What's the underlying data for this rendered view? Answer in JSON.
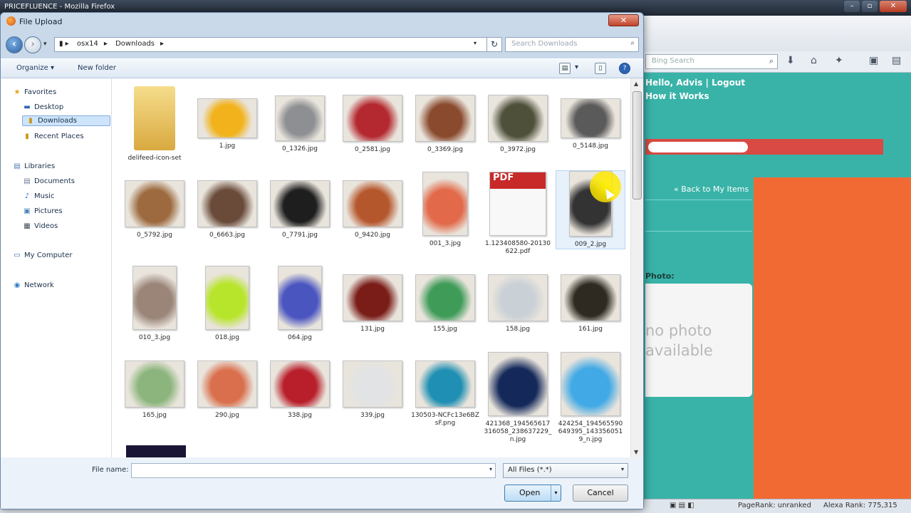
{
  "browser": {
    "title": "PRICEFLUENCE - Mozilla Firefox",
    "search_placeholder": "Bing Search",
    "greeting_line1": "Hello, Advis | Logout",
    "greeting_line2": "How it Works",
    "back_link": "« Back to My Items",
    "photo_label": "Photo:",
    "no_photo_line1": "no photo",
    "no_photo_line2": "available",
    "status_pagerank": "PageRank: unranked",
    "status_alexa": "Alexa Rank: 775,315",
    "colors": {
      "page_bg": "#39b3a8",
      "bar": "#d84a43",
      "panel": "#f26a33"
    }
  },
  "dialog": {
    "title": "File Upload",
    "close_label": "✕",
    "breadcrumb": [
      "osx14",
      "Downloads"
    ],
    "search_placeholder": "Search Downloads",
    "toolbar": {
      "organize": "Organize ▾",
      "new_folder": "New folder"
    },
    "nav": {
      "favorites": "Favorites",
      "desktop": "Desktop",
      "downloads": "Downloads",
      "recent": "Recent Places",
      "libraries": "Libraries",
      "documents": "Documents",
      "music": "Music",
      "pictures": "Pictures",
      "videos": "Videos",
      "computer": "My Computer",
      "network": "Network"
    },
    "files": [
      "delifeed-icon-set",
      "1.jpg",
      "0_1326.jpg",
      "0_2581.jpg",
      "0_3369.jpg",
      "0_3972.jpg",
      "0_5148.jpg",
      "0_5792.jpg",
      "0_6663.jpg",
      "0_7791.jpg",
      "0_9420.jpg",
      "001_3.jpg",
      "1.123408580-20130622.pdf",
      "009_2.jpg",
      "010_3.jpg",
      "018.jpg",
      "064.jpg",
      "131.jpg",
      "155.jpg",
      "158.jpg",
      "161.jpg",
      "165.jpg",
      "290.jpg",
      "338.jpg",
      "339.jpg",
      "130503-NCFc13e6BZsF.png",
      "421368_194565617316058_238637229_n.jpg",
      "424254_194565590649395_1433560519_n.jpg"
    ],
    "file_name_label": "File name:",
    "file_name_value": "",
    "file_type": "All Files (*.*)",
    "open_label": "Open",
    "cancel_label": "Cancel"
  }
}
